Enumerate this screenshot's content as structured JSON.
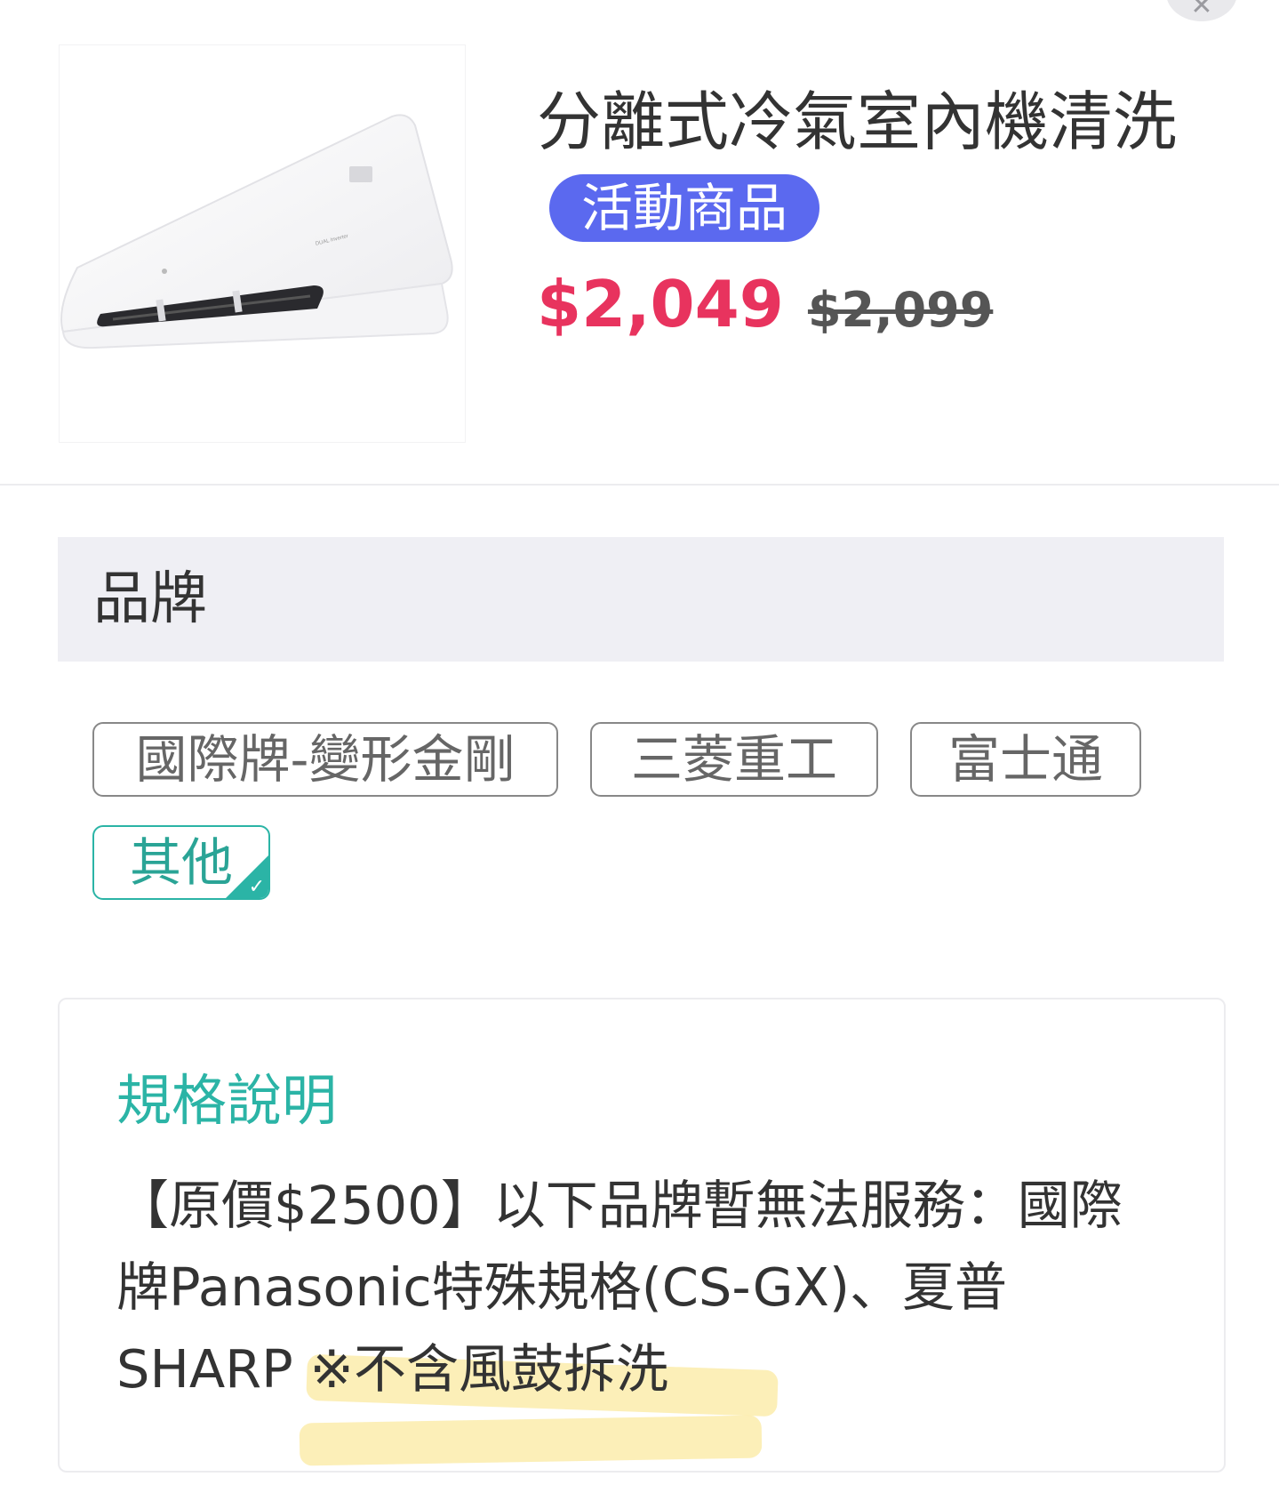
{
  "product": {
    "title": "分離式冷氣室內機清洗",
    "badge": "活動商品",
    "price": "$2,049",
    "original_price": "$2,099",
    "image": "air-conditioner-indoor-unit"
  },
  "brand_section": {
    "title": "品牌",
    "options": [
      {
        "label": "國際牌-變形金剛",
        "selected": false
      },
      {
        "label": "三菱重工",
        "selected": false
      },
      {
        "label": "富士通",
        "selected": false
      },
      {
        "label": "其他",
        "selected": true
      }
    ]
  },
  "spec": {
    "title": "規格說明",
    "description": "【原價$2500】以下品牌暫無法服務：國際牌Panasonic特殊規格(CS-GX)、夏普SHARP ※不含風鼓拆洗"
  },
  "colors": {
    "price": "#e8335e",
    "badge": "#5b69ef",
    "accent": "#2bb4a6",
    "highlight": "#fbeaa0"
  },
  "icons": {
    "close": "close-icon",
    "selected_check": "check-icon"
  }
}
